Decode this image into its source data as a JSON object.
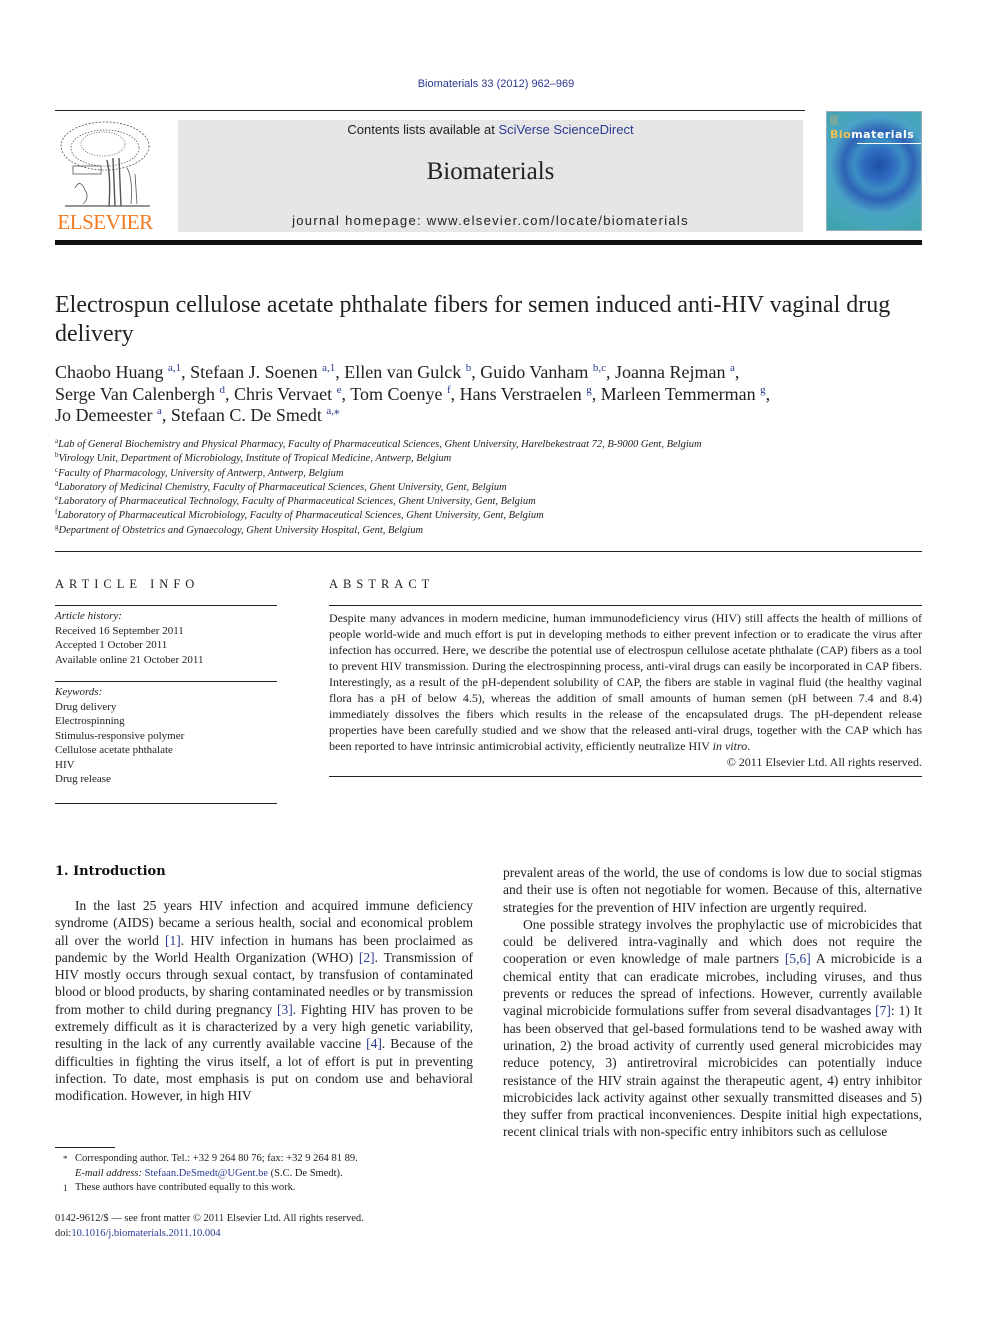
{
  "header": {
    "citation": "Biomaterials 33 (2012) 962–969",
    "contents_prefix": "Contents lists available at ",
    "contents_link": "SciVerse ScienceDirect",
    "journal_name": "Biomaterials",
    "homepage": "journal homepage: www.elsevier.com/locate/biomaterials",
    "publisher_logo_text": "ELSEVIER",
    "cover_title_bio": "Bio",
    "cover_title_rest": "materials"
  },
  "article": {
    "title": "Electrospun cellulose acetate phthalate fibers for semen induced anti-HIV vaginal drug delivery",
    "authors": [
      {
        "name": "Chaobo Huang",
        "aff": "a,1",
        "sep": ", "
      },
      {
        "name": "Stefaan J. Soenen",
        "aff": "a,1",
        "sep": ", "
      },
      {
        "name": "Ellen van Gulck",
        "aff": "b",
        "sep": ", "
      },
      {
        "name": "Guido Vanham",
        "aff": "b,c",
        "sep": ", "
      },
      {
        "name": "Joanna Rejman",
        "aff": "a",
        "sep": ", "
      },
      {
        "name": "Serge Van Calenbergh",
        "aff": "d",
        "sep": ", "
      },
      {
        "name": "Chris Vervaet",
        "aff": "e",
        "sep": ", "
      },
      {
        "name": "Tom Coenye",
        "aff": "f",
        "sep": ", "
      },
      {
        "name": "Hans Verstraelen",
        "aff": "g",
        "sep": ", "
      },
      {
        "name": "Marleen Temmerman",
        "aff": "g",
        "sep": ", "
      },
      {
        "name": "Jo Demeester",
        "aff": "a",
        "sep": ", "
      },
      {
        "name": "Stefaan C. De Smedt",
        "aff": "a,⁎",
        "sep": ""
      }
    ],
    "affiliations": [
      {
        "key": "a",
        "text": "Lab of General Biochemistry and Physical Pharmacy, Faculty of Pharmaceutical Sciences, Ghent University, Harelbekestraat 72, B-9000 Gent, Belgium"
      },
      {
        "key": "b",
        "text": "Virology Unit, Department of Microbiology, Institute of Tropical Medicine, Antwerp, Belgium"
      },
      {
        "key": "c",
        "text": "Faculty of Pharmacology, University of Antwerp, Antwerp, Belgium"
      },
      {
        "key": "d",
        "text": "Laboratory of Medicinal Chemistry, Faculty of Pharmaceutical Sciences, Ghent University, Gent, Belgium"
      },
      {
        "key": "e",
        "text": "Laboratory of Pharmaceutical Technology, Faculty of Pharmaceutical Sciences, Ghent University, Gent, Belgium"
      },
      {
        "key": "f",
        "text": "Laboratory of Pharmaceutical Microbiology, Faculty of Pharmaceutical Sciences, Ghent University, Gent, Belgium"
      },
      {
        "key": "g",
        "text": "Department of Obstetrics and Gynaecology, Ghent University Hospital, Gent, Belgium"
      }
    ]
  },
  "article_info": {
    "heading": "ARTICLE INFO",
    "history_label": "Article history:",
    "history": [
      "Received 16 September 2011",
      "Accepted 1 October 2011",
      "Available online 21 October 2011"
    ],
    "keywords_label": "Keywords:",
    "keywords": [
      "Drug delivery",
      "Electrospinning",
      "Stimulus-responsive polymer",
      "Cellulose acetate phthalate",
      "HIV",
      "Drug release"
    ]
  },
  "abstract": {
    "heading": "ABSTRACT",
    "text_before_italic": "Despite many advances in modern medicine, human immunodeficiency virus (HIV) still affects the health of millions of people world-wide and much effort is put in developing methods to either prevent infection or to eradicate the virus after infection has occurred. Here, we describe the potential use of electrospun cellulose acetate phthalate (CAP) fibers as a tool to prevent HIV transmission. During the electrospinning process, anti-viral drugs can easily be incorporated in CAP fibers. Interestingly, as a result of the pH-dependent solubility of CAP, the fibers are stable in vaginal fluid (the healthy vaginal flora has a pH of below 4.5), whereas the addition of small amounts of human semen (pH between 7.4 and 8.4) immediately dissolves the fibers which results in the release of the encapsulated drugs. The pH-dependent release properties have been carefully studied and we show that the released anti-viral drugs, together with the CAP which has been reported to have intrinsic antimicrobial activity, efficiently neutralize HIV ",
    "italic": "in vitro",
    "text_after_italic": ".",
    "copyright": "© 2011 Elsevier Ltd. All rights reserved."
  },
  "introduction": {
    "heading": "1.  Introduction",
    "left": [
      {
        "t": "In the last 25 years HIV infection and acquired immune deficiency syndrome (AIDS) became a serious health, social and economical problem all over the world "
      },
      {
        "ref": "[1]"
      },
      {
        "t": ". HIV infection in humans has been proclaimed as pandemic by the World Health Organization (WHO) "
      },
      {
        "ref": "[2]"
      },
      {
        "t": ". Transmission of HIV mostly occurs through sexual contact, by transfusion of contaminated blood or blood products, by sharing contaminated needles or by transmission from mother to child during pregnancy "
      },
      {
        "ref": "[3]"
      },
      {
        "t": ". Fighting HIV has proven to be extremely difficult as it is characterized by a very high genetic variability, resulting in the lack of any currently available vaccine "
      },
      {
        "ref": "[4]"
      },
      {
        "t": ". Because of the difficulties in fighting the virus itself, a lot of effort is put in preventing infection. To date, most emphasis is put on condom use and behavioral modification. However, in high HIV"
      }
    ],
    "right_p1": "prevalent areas of the world, the use of condoms is low due to social stigmas and their use is often not negotiable for women. Because of this, alternative strategies for the prevention of HIV infection are urgently required.",
    "right_p2": [
      {
        "t": "One possible strategy involves the prophylactic use of microbicides that could be delivered intra-vaginally and which does not require the cooperation or even knowledge of male partners "
      },
      {
        "ref": "[5,6]"
      },
      {
        "t": " A microbicide is a chemical entity that can eradicate microbes, including viruses, and thus prevents or reduces the spread of infections. However, currently available vaginal microbicide formulations suffer from several disadvantages "
      },
      {
        "ref": "[7]"
      },
      {
        "t": ": 1) It has been observed that gel-based formulations tend to be washed away with urination, 2) the broad activity of currently used general microbicides may reduce potency, 3) antiretroviral microbicides can potentially induce resistance of the HIV strain against the therapeutic agent, 4) entry inhibitor microbicides lack activity against other sexually transmitted diseases and 5) they suffer from practical inconveniences. Despite initial high expectations, recent clinical trials with non-specific entry inhibitors such as cellulose"
      }
    ]
  },
  "footnotes": {
    "corresponding_mark": "*",
    "corresponding": "Corresponding author. Tel.: +32 9 264 80 76; fax: +32 9 264 81 89.",
    "email_label": "E-mail address: ",
    "email": "Stefaan.DeSmedt@UGent.be",
    "email_suffix": " (S.C. De Smedt).",
    "equal_mark": "1",
    "equal": "These authors have contributed equally to this work.",
    "front_matter": "0142-9612/$ — see front matter © 2011 Elsevier Ltd. All rights reserved.",
    "doi_label": "doi:",
    "doi": "10.1016/j.biomaterials.2011.10.004"
  }
}
